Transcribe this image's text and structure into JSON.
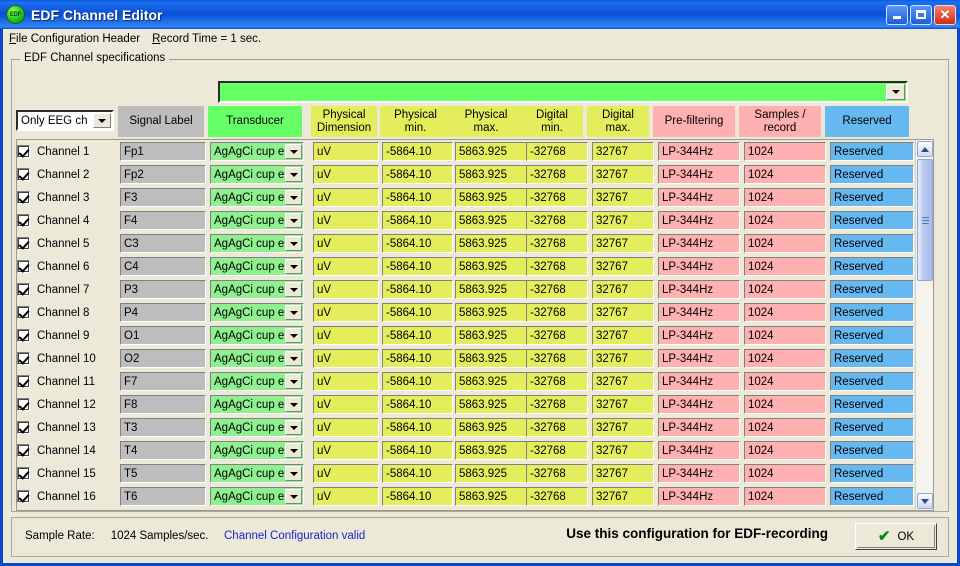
{
  "window": {
    "title": "EDF Channel Editor",
    "icon": "edf-app-icon",
    "buttons": {
      "minimize": "minimize",
      "maximize": "maximize",
      "close": "close"
    }
  },
  "menubar": {
    "items": [
      {
        "label": "File Configuration Header",
        "accel": "F"
      },
      {
        "label": "Record Time = 1 sec.",
        "accel": "R"
      }
    ]
  },
  "groupbox": {
    "label": "EDF Channel specifications"
  },
  "top_combo": {
    "value": "",
    "color": "#66ff66"
  },
  "filter_combo": {
    "value": "Only EEG ch"
  },
  "columns": [
    {
      "key": "channel",
      "label": "",
      "label2": "",
      "color": ""
    },
    {
      "key": "signal",
      "label": "Signal Label",
      "label2": "",
      "color": "#bdbdbd"
    },
    {
      "key": "transducer",
      "label": "Transducer",
      "label2": "",
      "color": "#66ff66"
    },
    {
      "key": "phys_dim",
      "label": "Physical",
      "label2": "Dimension",
      "color": "#e4ee5c"
    },
    {
      "key": "phys_min",
      "label": "Physical",
      "label2": "min.",
      "color": "#e4ee5c"
    },
    {
      "key": "phys_max",
      "label": "Physical",
      "label2": "max.",
      "color": "#e4ee5c"
    },
    {
      "key": "dig_min",
      "label": "Digital",
      "label2": "min.",
      "color": "#e4ee5c"
    },
    {
      "key": "dig_max",
      "label": "Digital",
      "label2": "max.",
      "color": "#e4ee5c"
    },
    {
      "key": "prefilter",
      "label": "Pre-filtering",
      "label2": "",
      "color": "#ffb0b0"
    },
    {
      "key": "samples",
      "label": "Samples /",
      "label2": "record",
      "color": "#ffb0b0"
    },
    {
      "key": "reserved",
      "label": "Reserved",
      "label2": "",
      "color": "#66b8f0"
    }
  ],
  "rows": [
    {
      "checked": true,
      "channel": "Channel 1",
      "signal": "Fp1",
      "transducer": "AgAgCi cup e",
      "phys_dim": "uV",
      "phys_min": "-5864.10",
      "phys_max": "5863.925",
      "dig_min": "-32768",
      "dig_max": "32767",
      "prefilter": "LP-344Hz",
      "samples": "1024",
      "reserved": "Reserved"
    },
    {
      "checked": true,
      "channel": "Channel 2",
      "signal": "Fp2",
      "transducer": "AgAgCi cup e",
      "phys_dim": "uV",
      "phys_min": "-5864.10",
      "phys_max": "5863.925",
      "dig_min": "-32768",
      "dig_max": "32767",
      "prefilter": "LP-344Hz",
      "samples": "1024",
      "reserved": "Reserved"
    },
    {
      "checked": true,
      "channel": "Channel 3",
      "signal": "F3",
      "transducer": "AgAgCi cup e",
      "phys_dim": "uV",
      "phys_min": "-5864.10",
      "phys_max": "5863.925",
      "dig_min": "-32768",
      "dig_max": "32767",
      "prefilter": "LP-344Hz",
      "samples": "1024",
      "reserved": "Reserved"
    },
    {
      "checked": true,
      "channel": "Channel 4",
      "signal": "F4",
      "transducer": "AgAgCi cup e",
      "phys_dim": "uV",
      "phys_min": "-5864.10",
      "phys_max": "5863.925",
      "dig_min": "-32768",
      "dig_max": "32767",
      "prefilter": "LP-344Hz",
      "samples": "1024",
      "reserved": "Reserved"
    },
    {
      "checked": true,
      "channel": "Channel 5",
      "signal": "C3",
      "transducer": "AgAgCi cup e",
      "phys_dim": "uV",
      "phys_min": "-5864.10",
      "phys_max": "5863.925",
      "dig_min": "-32768",
      "dig_max": "32767",
      "prefilter": "LP-344Hz",
      "samples": "1024",
      "reserved": "Reserved"
    },
    {
      "checked": true,
      "channel": "Channel 6",
      "signal": "C4",
      "transducer": "AgAgCi cup e",
      "phys_dim": "uV",
      "phys_min": "-5864.10",
      "phys_max": "5863.925",
      "dig_min": "-32768",
      "dig_max": "32767",
      "prefilter": "LP-344Hz",
      "samples": "1024",
      "reserved": "Reserved"
    },
    {
      "checked": true,
      "channel": "Channel 7",
      "signal": "P3",
      "transducer": "AgAgCi cup e",
      "phys_dim": "uV",
      "phys_min": "-5864.10",
      "phys_max": "5863.925",
      "dig_min": "-32768",
      "dig_max": "32767",
      "prefilter": "LP-344Hz",
      "samples": "1024",
      "reserved": "Reserved"
    },
    {
      "checked": true,
      "channel": "Channel 8",
      "signal": "P4",
      "transducer": "AgAgCi cup e",
      "phys_dim": "uV",
      "phys_min": "-5864.10",
      "phys_max": "5863.925",
      "dig_min": "-32768",
      "dig_max": "32767",
      "prefilter": "LP-344Hz",
      "samples": "1024",
      "reserved": "Reserved"
    },
    {
      "checked": true,
      "channel": "Channel 9",
      "signal": "O1",
      "transducer": "AgAgCi cup e",
      "phys_dim": "uV",
      "phys_min": "-5864.10",
      "phys_max": "5863.925",
      "dig_min": "-32768",
      "dig_max": "32767",
      "prefilter": "LP-344Hz",
      "samples": "1024",
      "reserved": "Reserved"
    },
    {
      "checked": true,
      "channel": "Channel 10",
      "signal": "O2",
      "transducer": "AgAgCi cup e",
      "phys_dim": "uV",
      "phys_min": "-5864.10",
      "phys_max": "5863.925",
      "dig_min": "-32768",
      "dig_max": "32767",
      "prefilter": "LP-344Hz",
      "samples": "1024",
      "reserved": "Reserved"
    },
    {
      "checked": true,
      "channel": "Channel 11",
      "signal": "F7",
      "transducer": "AgAgCi cup e",
      "phys_dim": "uV",
      "phys_min": "-5864.10",
      "phys_max": "5863.925",
      "dig_min": "-32768",
      "dig_max": "32767",
      "prefilter": "LP-344Hz",
      "samples": "1024",
      "reserved": "Reserved"
    },
    {
      "checked": true,
      "channel": "Channel 12",
      "signal": "F8",
      "transducer": "AgAgCi cup e",
      "phys_dim": "uV",
      "phys_min": "-5864.10",
      "phys_max": "5863.925",
      "dig_min": "-32768",
      "dig_max": "32767",
      "prefilter": "LP-344Hz",
      "samples": "1024",
      "reserved": "Reserved"
    },
    {
      "checked": true,
      "channel": "Channel 13",
      "signal": "T3",
      "transducer": "AgAgCi cup e",
      "phys_dim": "uV",
      "phys_min": "-5864.10",
      "phys_max": "5863.925",
      "dig_min": "-32768",
      "dig_max": "32767",
      "prefilter": "LP-344Hz",
      "samples": "1024",
      "reserved": "Reserved"
    },
    {
      "checked": true,
      "channel": "Channel 14",
      "signal": "T4",
      "transducer": "AgAgCi cup e",
      "phys_dim": "uV",
      "phys_min": "-5864.10",
      "phys_max": "5863.925",
      "dig_min": "-32768",
      "dig_max": "32767",
      "prefilter": "LP-344Hz",
      "samples": "1024",
      "reserved": "Reserved"
    },
    {
      "checked": true,
      "channel": "Channel 15",
      "signal": "T5",
      "transducer": "AgAgCi cup e",
      "phys_dim": "uV",
      "phys_min": "-5864.10",
      "phys_max": "5863.925",
      "dig_min": "-32768",
      "dig_max": "32767",
      "prefilter": "LP-344Hz",
      "samples": "1024",
      "reserved": "Reserved"
    },
    {
      "checked": true,
      "channel": "Channel 16",
      "signal": "T6",
      "transducer": "AgAgCi cup e",
      "phys_dim": "uV",
      "phys_min": "-5864.10",
      "phys_max": "5863.925",
      "dig_min": "-32768",
      "dig_max": "32767",
      "prefilter": "LP-344Hz",
      "samples": "1024",
      "reserved": "Reserved"
    }
  ],
  "statusbar": {
    "sample_rate_label": "Sample Rate:",
    "sample_rate_value": "1024 Samples/sec.",
    "validity": "Channel Configuration valid",
    "use_config": "Use this configuration for EDF-recording",
    "ok_label": "OK"
  }
}
